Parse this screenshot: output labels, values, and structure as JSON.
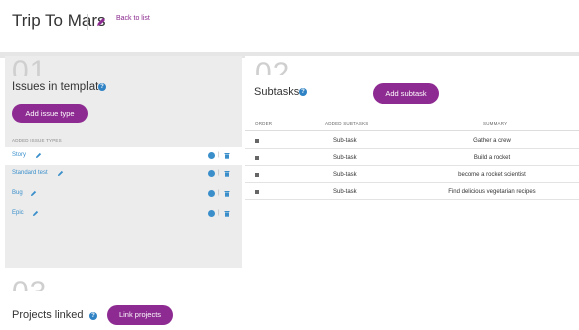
{
  "header": {
    "title": "Trip To Mars",
    "back_label": "Back to list"
  },
  "issues_panel": {
    "number": "01",
    "title": "Issues in template",
    "add_button": "Add issue type",
    "added_label": "ADDED ISSUE TYPES",
    "items": [
      {
        "name": "Story",
        "active": true
      },
      {
        "name": "Standard test",
        "active": false
      },
      {
        "name": "Bug",
        "active": false
      },
      {
        "name": "Epic",
        "active": false
      }
    ]
  },
  "subtasks_panel": {
    "number": "02",
    "title": "Subtasks",
    "add_button": "Add subtask",
    "columns": [
      "ORDER",
      "ADDED SUBTASKS",
      "SUMMARY"
    ],
    "rows": [
      {
        "subtask": "Sub-task",
        "summary": "Gather a crew"
      },
      {
        "subtask": "Sub-task",
        "summary": "Build a rocket"
      },
      {
        "subtask": "Sub-task",
        "summary": "become a rocket scientist"
      },
      {
        "subtask": "Sub-task",
        "summary": "Find delicious vegetarian recipes"
      }
    ]
  },
  "projects_panel": {
    "number": "03",
    "title": "Projects linked",
    "link_button": "Link projects"
  },
  "colors": {
    "accent": "#8e2b92",
    "link": "#3a8fcb",
    "help": "#2f82c4"
  },
  "icons": {
    "edit": "pencil-icon",
    "help": "help-icon",
    "delete": "trash-icon",
    "count": "badge-icon",
    "drag": "drag-handle-icon"
  }
}
